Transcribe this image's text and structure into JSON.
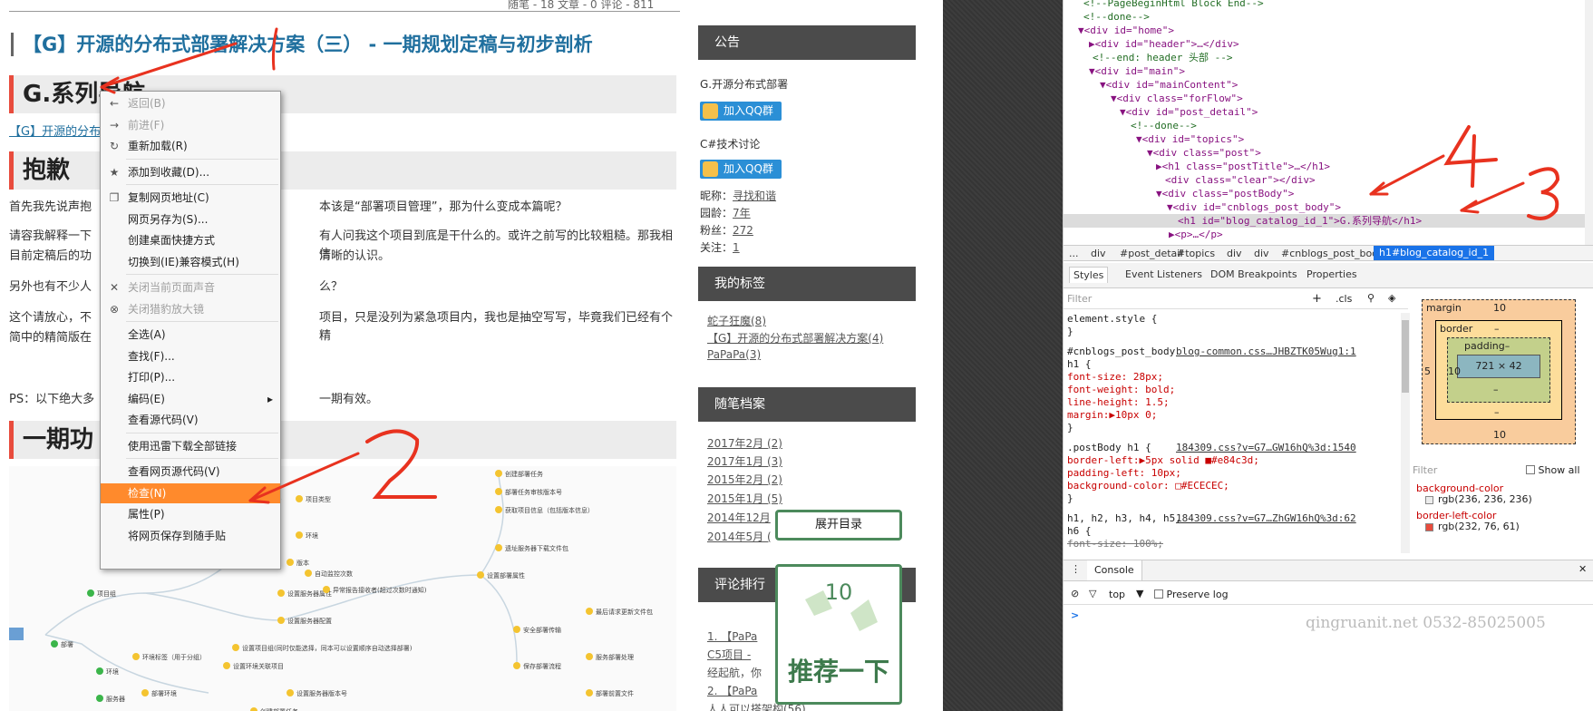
{
  "article": {
    "top_stats": "随笔 - 18  文章 - 0  评论 - 811",
    "title": "【G】开源的分布式部署解决方案（三） - 一期规划定稿与初步剖析",
    "h1_nav": "G.系列导航",
    "nav_link": "【G】开源的分布",
    "h1_sorry": "抱歉",
    "p1": "首先我先说声抱",
    "p1_tail": "本该是“部署项目管理”，那为什么变成本篇呢？",
    "p2a": "请容我解释一下",
    "p2a_tail": "有人问我这个项目到底是干什么的。或许之前写的比较粗糙。那我相信",
    "p2b": "目前定稿后的功",
    "p2b_tail": "清晰的认识。",
    "p3": "另外也有不少人",
    "p3_tail": "么？",
    "p4a": "这个请放心，不",
    "p4a_tail": "项目，只是没列为紧急项目内，我也是抽空写写，毕竟我们已经有个精",
    "p4b": "简中的精简版在",
    "ps": "PS：以下绝大多",
    "ps_tail": "一期有效。",
    "h1_phase": "一期功",
    "mindmap_nodes": [
      "项目组",
      "部署",
      "环境",
      "服务器",
      "项目类型",
      "环境",
      "版本",
      "部署环境",
      "环境标签（用于分组）",
      "设置服务器属性",
      "设置服务器配置",
      "自动监控次数",
      "异常报告接收者(超过次数时通知)",
      "设置部署属性",
      "创建部署任务",
      "部署任务审核版本号",
      "获取项目信息（包括版本信息）",
      "遗址服务器下载文件包",
      "安全部署传输",
      "保存部署流程",
      "最后请求更新文件包",
      "服务部署处理",
      "部署前置文件",
      "设置环境关联项目",
      "设置项目组(同时仅能选择，同本可以设置顺序自动选择部署)",
      "设置服务器版本号",
      "创建部署任务"
    ]
  },
  "sidebar": {
    "notice_title": "公告",
    "notice_text": "G.开源分布式部署",
    "qq_label": "加入QQ群",
    "qq_label2": "加入QQ群",
    "csharp": "C#技术讨论",
    "nick": "昵称：",
    "nick_val": "寻找和谐",
    "age": "园龄：",
    "age_val": "7年",
    "fans": "粉丝：",
    "fans_val": "272",
    "follow": "关注：",
    "follow_val": "1",
    "tags_title": "我的标签",
    "tags": [
      "蛇子狂魔(8)",
      "【G】开源的分布式部署解决方案(4)",
      "PaPaPa(3)"
    ],
    "archive_title": "随笔档案",
    "archives": [
      "2017年2月 (2)",
      "2017年1月 (3)",
      "2015年2月 (2)",
      "2015年1月 (5)",
      "2014年12月",
      "2014年5月 ("
    ],
    "comments_title": "评论排行",
    "comments": [
      "1. 【PaPa",
      "C5项目 - ",
      "经起航，你",
      "2. 【PaPa",
      "人人可以搭架构(56)"
    ]
  },
  "expand_button": "展开目录",
  "recommend": {
    "count": "10",
    "label": "推荐一下"
  },
  "context_menu": {
    "items": [
      {
        "label": "返回(B)",
        "icon": "arrow-left-icon",
        "disabled": true
      },
      {
        "label": "前进(F)",
        "icon": "arrow-right-icon",
        "disabled": true
      },
      {
        "label": "重新加载(R)",
        "icon": "reload-icon",
        "disabled": false
      },
      {
        "label": "添加到收藏(D)...",
        "icon": "star-icon",
        "disabled": false
      },
      {
        "label": "复制网页地址(C)",
        "icon": "copy-icon",
        "disabled": false
      },
      {
        "label": "网页另存为(S)...",
        "icon": "",
        "disabled": false
      },
      {
        "label": "创建桌面快捷方式",
        "icon": "",
        "disabled": false
      },
      {
        "label": "切换到(IE)兼容模式(H)",
        "icon": "",
        "disabled": false
      },
      {
        "label": "关闭当前页面声音",
        "icon": "mute-icon",
        "disabled": true
      },
      {
        "label": "关闭猎豹放大镜",
        "icon": "magnifier-icon",
        "disabled": true
      },
      {
        "label": "全选(A)",
        "icon": "",
        "disabled": false
      },
      {
        "label": "查找(F)...",
        "icon": "",
        "disabled": false
      },
      {
        "label": "打印(P)...",
        "icon": "",
        "disabled": false
      },
      {
        "label": "编码(E)",
        "icon": "",
        "disabled": false,
        "submenu": true
      },
      {
        "label": "查看源代码(V)",
        "icon": "",
        "disabled": false
      },
      {
        "label": "使用迅雷下载全部链接",
        "icon": "",
        "disabled": false
      },
      {
        "label": "查看网页源代码(V)",
        "icon": "",
        "disabled": false
      },
      {
        "label": "检查(N)",
        "icon": "",
        "disabled": false,
        "highlighted": true
      },
      {
        "label": "属性(P)",
        "icon": "",
        "disabled": false
      },
      {
        "label": "将网页保存到随手贴",
        "icon": "",
        "disabled": false
      }
    ]
  },
  "devtools": {
    "dom": [
      {
        "t": "<!--PageBeginHtml Block End-->",
        "k": "cm"
      },
      {
        "t": "<!--done-->",
        "k": "cm"
      },
      {
        "t": "▼<div id=\"home\">",
        "k": "tag"
      },
      {
        "t": "▶<div id=\"header\">…</div>",
        "k": "tag"
      },
      {
        "t": "<!--end: header 头部 -->",
        "k": "cm"
      },
      {
        "t": "▼<div id=\"main\">",
        "k": "tag"
      },
      {
        "t": "▼<div id=\"mainContent\">",
        "k": "tag"
      },
      {
        "t": "▼<div class=\"forFlow\">",
        "k": "tag"
      },
      {
        "t": "▼<div id=\"post_detail\">",
        "k": "tag"
      },
      {
        "t": "<!--done-->",
        "k": "cm"
      },
      {
        "t": "▼<div id=\"topics\">",
        "k": "tag"
      },
      {
        "t": "▼<div class=\"post\">",
        "k": "tag"
      },
      {
        "t": "▶<h1 class=\"postTitle\">…</h1>",
        "k": "tag"
      },
      {
        "t": "<div class=\"clear\"></div>",
        "k": "tag"
      },
      {
        "t": "▼<div class=\"postBody\">",
        "k": "tag"
      },
      {
        "t": "▼<div id=\"cnblogs_post_body\">",
        "k": "tag"
      },
      {
        "t": "<h1 id=\"blog_catalog_id_1\">G.系列导航</h1>",
        "k": "tag"
      },
      {
        "t": "▶<p>…</p>",
        "k": "tag"
      }
    ],
    "breadcrumbs": [
      "...",
      "div",
      "#post_detail",
      "#topics",
      "div",
      "div",
      "#cnblogs_post_body",
      "h1#blog_catalog_id_1"
    ],
    "tabs": [
      "Styles",
      "Event Listeners",
      "DOM Breakpoints",
      "Properties"
    ],
    "filter_placeholder": "Filter",
    "cls_label": ".cls",
    "css": [
      {
        "t": "element.style {",
        "k": "sel"
      },
      {
        "t": "}",
        "k": "sel"
      },
      {
        "t": "#cnblogs_post_body",
        "k": "sel",
        "src": "blog-common.css…JHBZTK05Wug1:1"
      },
      {
        "t": "h1 {",
        "k": "sel"
      },
      {
        "t": "  font-size: 28px;",
        "k": "prop"
      },
      {
        "t": "  font-weight: bold;",
        "k": "prop"
      },
      {
        "t": "  line-height: 1.5;",
        "k": "prop"
      },
      {
        "t": "  margin:▶10px 0;",
        "k": "prop"
      },
      {
        "t": "}",
        "k": "sel"
      },
      {
        "t": ".postBody h1 {",
        "k": "sel",
        "src": "184309.css?v=G7…GW16hQ%3d:1540"
      },
      {
        "t": "  border-left:▶5px solid ■#e84c3d;",
        "k": "prop"
      },
      {
        "t": "  padding-left: 10px;",
        "k": "prop"
      },
      {
        "t": "  background-color: □#ECECEC;",
        "k": "prop"
      },
      {
        "t": "}",
        "k": "sel"
      },
      {
        "t": "h1, h2, h3, h4, h5,",
        "k": "sel",
        "src": "184309.css?v=G7…ZhGW16hQ%3d:62"
      },
      {
        "t": "h6 {",
        "k": "sel"
      },
      {
        "t": "  font-size: 100%;",
        "k": "strike"
      }
    ],
    "box": {
      "margin": "margin",
      "margin_val": "10",
      "margin_bottom": "10",
      "border": "border",
      "border_val": "–",
      "padding": "padding–",
      "content": "721 × 42",
      "left": "5",
      "left2": "10",
      "dash": "–"
    },
    "computed_filter": "Filter",
    "show_all": "Show all",
    "computed": [
      {
        "name": "background-color",
        "value": "rgb(236, 236, 236)",
        "swatch": "#ececec"
      },
      {
        "name": "border-left-color",
        "value": "rgb(232, 76, 61)",
        "swatch": "#e84c3d"
      }
    ],
    "console_tab": "Console",
    "console_context": "top",
    "preserve_log": "Preserve log",
    "console_prompt": ">"
  },
  "annotations": [
    "1",
    "2",
    "3",
    "4"
  ],
  "watermark": "qingruanit.net 0532-85025005",
  "colors": {
    "accent_red": "#e84c3d",
    "link_blue": "#1f6f9e",
    "menu_highlight": "#ff8a2c",
    "qq_blue": "#2b8fd6"
  }
}
